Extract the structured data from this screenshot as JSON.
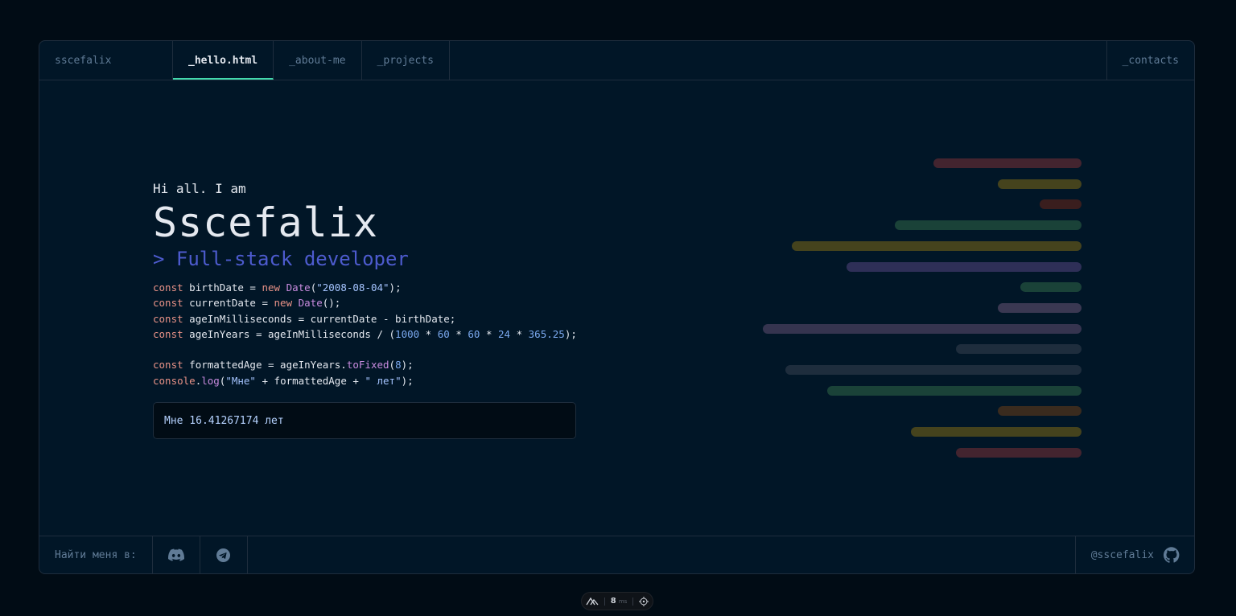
{
  "header": {
    "brand": "sscefalix",
    "tabs": [
      {
        "label": "_hello.html",
        "active": true
      },
      {
        "label": "_about-me",
        "active": false
      },
      {
        "label": "_projects",
        "active": false
      }
    ],
    "contacts": "_contacts"
  },
  "hero": {
    "greeting": "Hi all. I am",
    "name": "Sscefalix",
    "role": "> Full-stack developer"
  },
  "code": {
    "birth_date": "\"2008-08-04\"",
    "lines": [
      "const birthDate = new Date(\"2008-08-04\");",
      "const currentDate = new Date();",
      "const ageInMilliseconds = currentDate - birthDate;",
      "const ageInYears = ageInMilliseconds / (1000 * 60 * 60 * 24 * 365.25);",
      "",
      "const formattedAge = ageInYears.toFixed(8);",
      "console.log(\"Мне\" + formattedAge + \" лет\");"
    ],
    "output": "Мне 16.41267174 лет"
  },
  "decorative_bars": {
    "colors": [
      "#43242f",
      "#45431d",
      "#3a1e1e",
      "#1a4238",
      "#45431d",
      "#2e2f57",
      "#1a4238",
      "#3a3852",
      "#35344f",
      "#1e2d3d",
      "#1e2d3d",
      "#1a4238",
      "#3a2b1e",
      "#45431d",
      "#43242f"
    ],
    "lengths": [
      0.46,
      0.26,
      0.13,
      0.58,
      0.9,
      0.73,
      0.19,
      0.26,
      0.99,
      0.39,
      0.92,
      0.79,
      0.26,
      0.53,
      0.39
    ]
  },
  "footer": {
    "label": "Найти меня в:",
    "icons": [
      "discord-icon",
      "telegram-icon"
    ],
    "handle": "@sscefalix",
    "handle_icon": "github-icon"
  },
  "devtools": {
    "value": "8",
    "unit": "ms"
  },
  "colors": {
    "accent": "#43d9ad",
    "role": "#4d5bce",
    "background": "#011627",
    "border": "#1e2d3d"
  }
}
